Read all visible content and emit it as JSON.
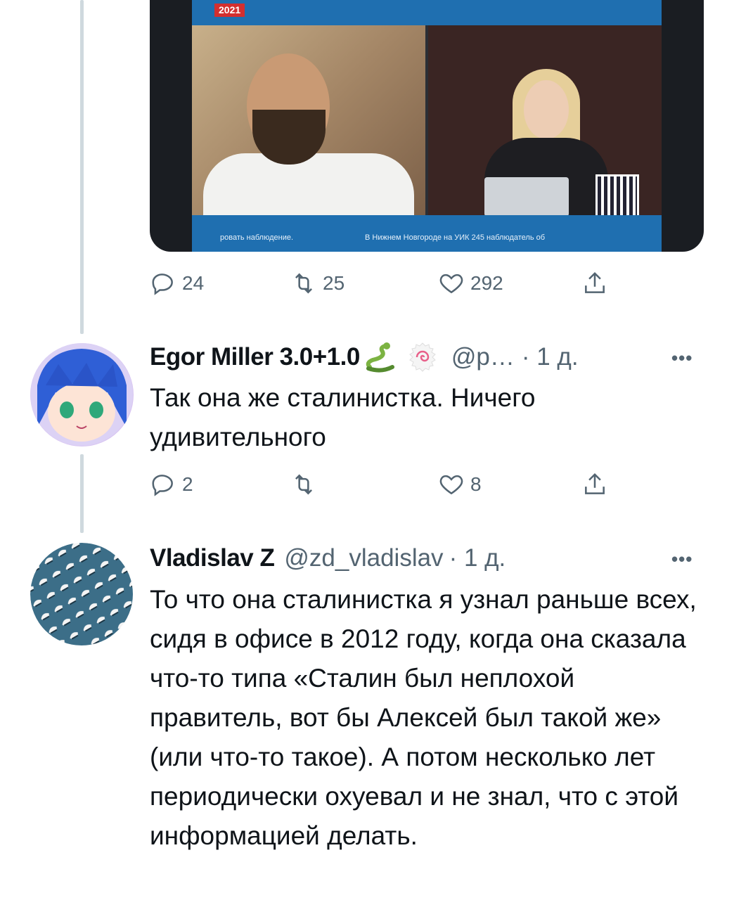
{
  "video": {
    "badge": "2021",
    "ticker_left": "ровать наблюдение.",
    "ticker_right": "В Нижнем Новгороде на УИК 245 наблюдатель об"
  },
  "tweet1_actions": {
    "replies": "24",
    "retweets": "25",
    "likes": "292"
  },
  "tweet2": {
    "name": "Egor Miller 3.0+1.0",
    "emoji": [
      "snake-emoji",
      "fishcake-emoji"
    ],
    "handle": "@р…",
    "time": "· 1 д.",
    "more": "•••",
    "text": "Так она же сталинистка. Ничего удивительного",
    "replies": "2",
    "retweets": "",
    "likes": "8"
  },
  "tweet3": {
    "name": "Vladislav Z",
    "handle": "@zd_vladislav",
    "time": "· 1 д.",
    "more": "•••",
    "text": "То что она сталинистка я узнал раньше всех, сидя в офисе в 2012 году, когда она сказала что-то типа «Сталин был неплохой правитель, вот бы Алексей был такой же» (или что-то такое). А потом несколько лет периодически охуевал и не знал, что с этой информацией делать."
  },
  "colors": {
    "text": "#0f1419",
    "secondary": "#536471",
    "thread_line": "#cfd9de",
    "video_blue": "#1f6fb0"
  }
}
